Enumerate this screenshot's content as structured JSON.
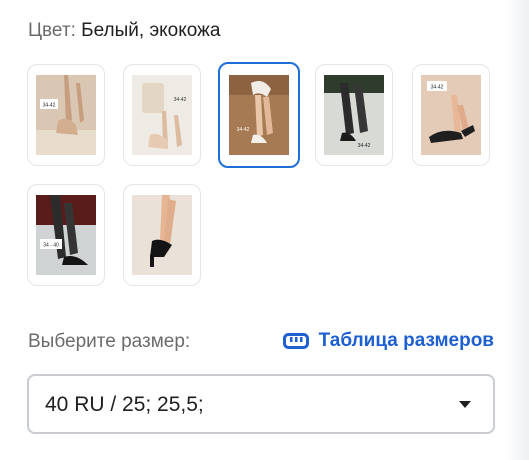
{
  "color": {
    "label": "Цвет:",
    "value": "Белый, экокожа"
  },
  "swatches": [
    {
      "name": "Beige pumps",
      "badge": "34-42",
      "selected": false
    },
    {
      "name": "Nude ankle-strap",
      "badge": "34-42",
      "selected": false
    },
    {
      "name": "White strappy heels",
      "badge": "34-42",
      "selected": true
    },
    {
      "name": "Black tights heels",
      "badge": "34-42",
      "selected": false
    },
    {
      "name": "Black cross-strap",
      "badge": "34-42",
      "selected": false
    },
    {
      "name": "Black ankle-strap",
      "badge": "34 - 40",
      "selected": false
    },
    {
      "name": "Black stilettos",
      "badge": "",
      "selected": false
    }
  ],
  "size": {
    "prompt": "Выберите размер:",
    "table_link": "Таблица размеров",
    "selected_value": "40 RU / 25; 25,5;"
  },
  "colors": {
    "accent": "#1e6fd9",
    "link": "#1e5fd1",
    "muted_text": "#6b6b6b",
    "border": "#c9cdd2"
  },
  "icons": {
    "size_table": "ruler-icon",
    "select": "caret-down-icon"
  }
}
